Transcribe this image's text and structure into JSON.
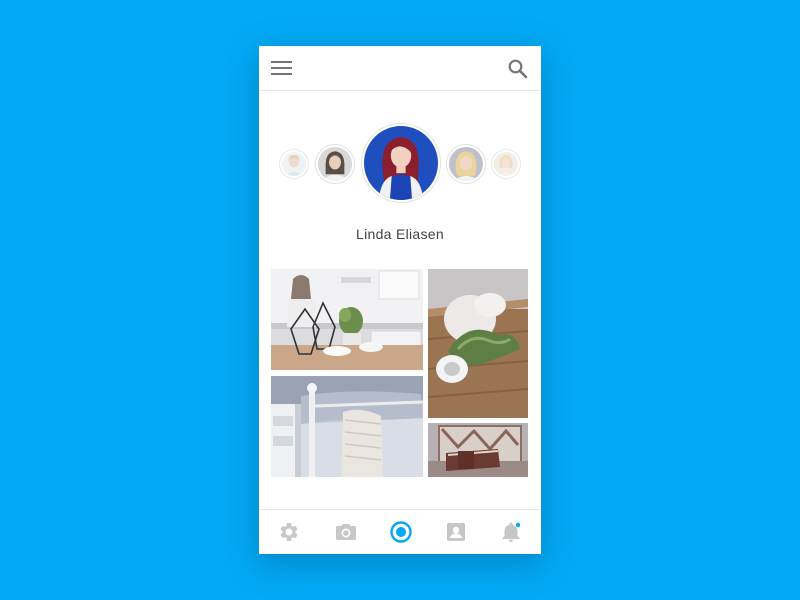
{
  "profile": {
    "name": "Linda Eliasen"
  },
  "colors": {
    "background": "#03a9f4",
    "accent": "#03a9f4",
    "icon_inactive": "#c7c7c7",
    "appbar_icon": "#757575"
  },
  "appbar": {
    "menu_icon": "menu-icon",
    "search_icon": "search-icon"
  },
  "avatars": [
    {
      "icon": "avatar-far-left"
    },
    {
      "icon": "avatar-left"
    },
    {
      "icon": "avatar-selected"
    },
    {
      "icon": "avatar-right"
    },
    {
      "icon": "avatar-far-right"
    }
  ],
  "photos": [
    {
      "icon": "kitchen-terrarium-photo"
    },
    {
      "icon": "table-plant-photo"
    },
    {
      "icon": "bedroom-blanket-photo"
    },
    {
      "icon": "book-shelf-photo"
    }
  ],
  "bottom_nav": {
    "items": [
      {
        "icon": "settings-icon",
        "active": false
      },
      {
        "icon": "camera-icon",
        "active": false
      },
      {
        "icon": "record-icon",
        "active": true
      },
      {
        "icon": "contacts-icon",
        "active": false
      },
      {
        "icon": "notifications-icon",
        "active": false,
        "badge": true
      }
    ]
  }
}
